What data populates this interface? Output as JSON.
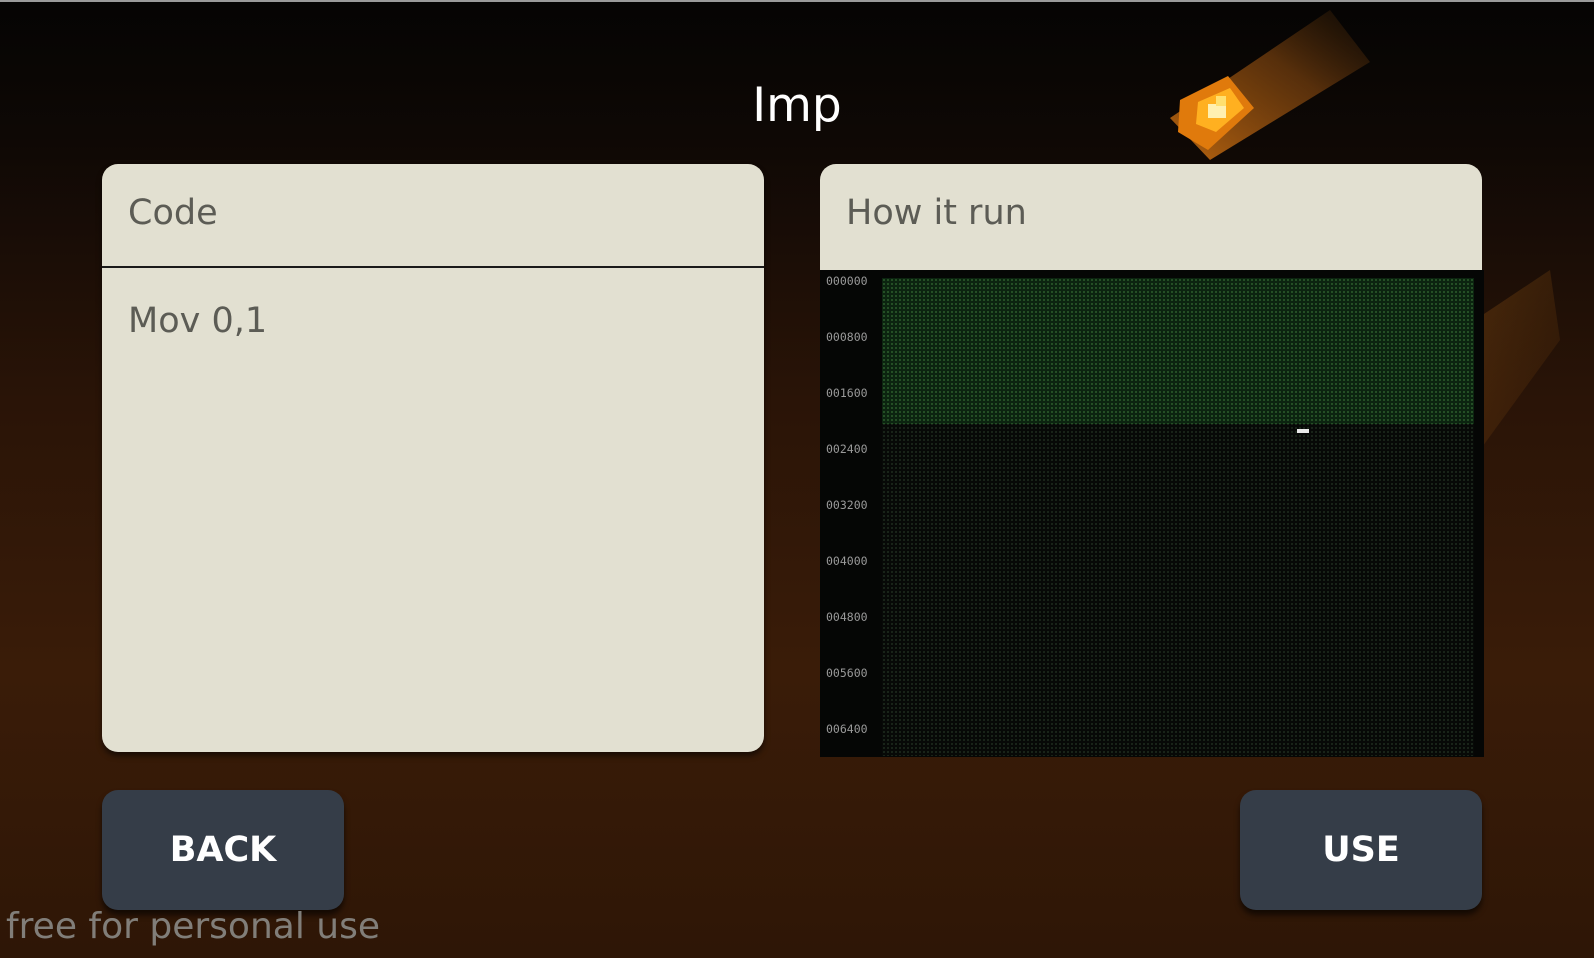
{
  "title": "Imp",
  "code_panel": {
    "header": "Code",
    "code": "Mov 0,1"
  },
  "run_panel": {
    "header": "How it run",
    "row_labels": [
      "000000",
      "000800",
      "001600",
      "002400",
      "003200",
      "004000",
      "004800",
      "005600",
      "006400"
    ]
  },
  "buttons": {
    "back": "BACK",
    "use": "USE"
  },
  "watermark": "free for personal use",
  "colors": {
    "panel_bg": "#e2e0d1",
    "button_bg": "#353d48",
    "core_active": "#0c2410"
  },
  "icons": {
    "decoration": "meteor-icon"
  }
}
